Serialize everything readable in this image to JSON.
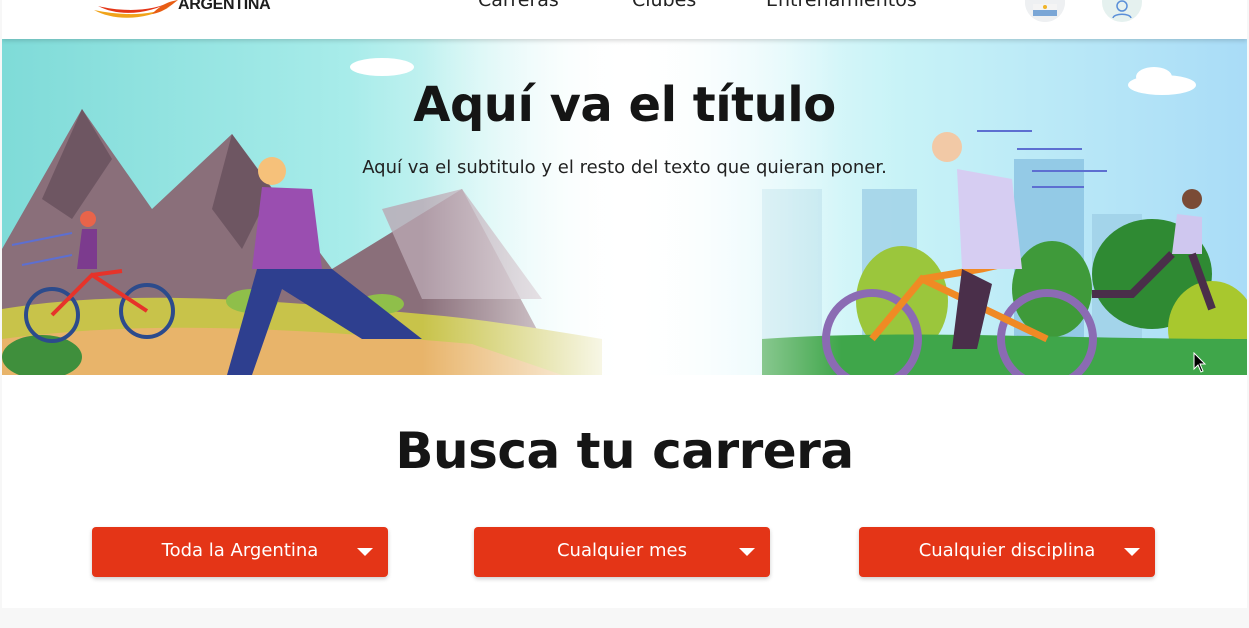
{
  "header": {
    "logo_text": "ARGENTINA",
    "nav": [
      {
        "label": "Carreras"
      },
      {
        "label": "Clubes"
      },
      {
        "label": "Entrenamientos"
      }
    ]
  },
  "hero": {
    "title": "Aquí va el título",
    "subtitle": "Aquí va el subtitulo y el resto del texto que quieran poner."
  },
  "search": {
    "title": "Busca tu carrera",
    "filters": [
      {
        "label": "Toda la Argentina"
      },
      {
        "label": "Cualquier mes"
      },
      {
        "label": "Cualquier disciplina"
      }
    ]
  },
  "colors": {
    "accent": "#e43517",
    "title": "#151515"
  },
  "icons": {
    "flag": "argentina-flag-icon",
    "user": "user-icon",
    "dropdown": "caret-down-icon",
    "cursor": "mouse-pointer-icon"
  }
}
